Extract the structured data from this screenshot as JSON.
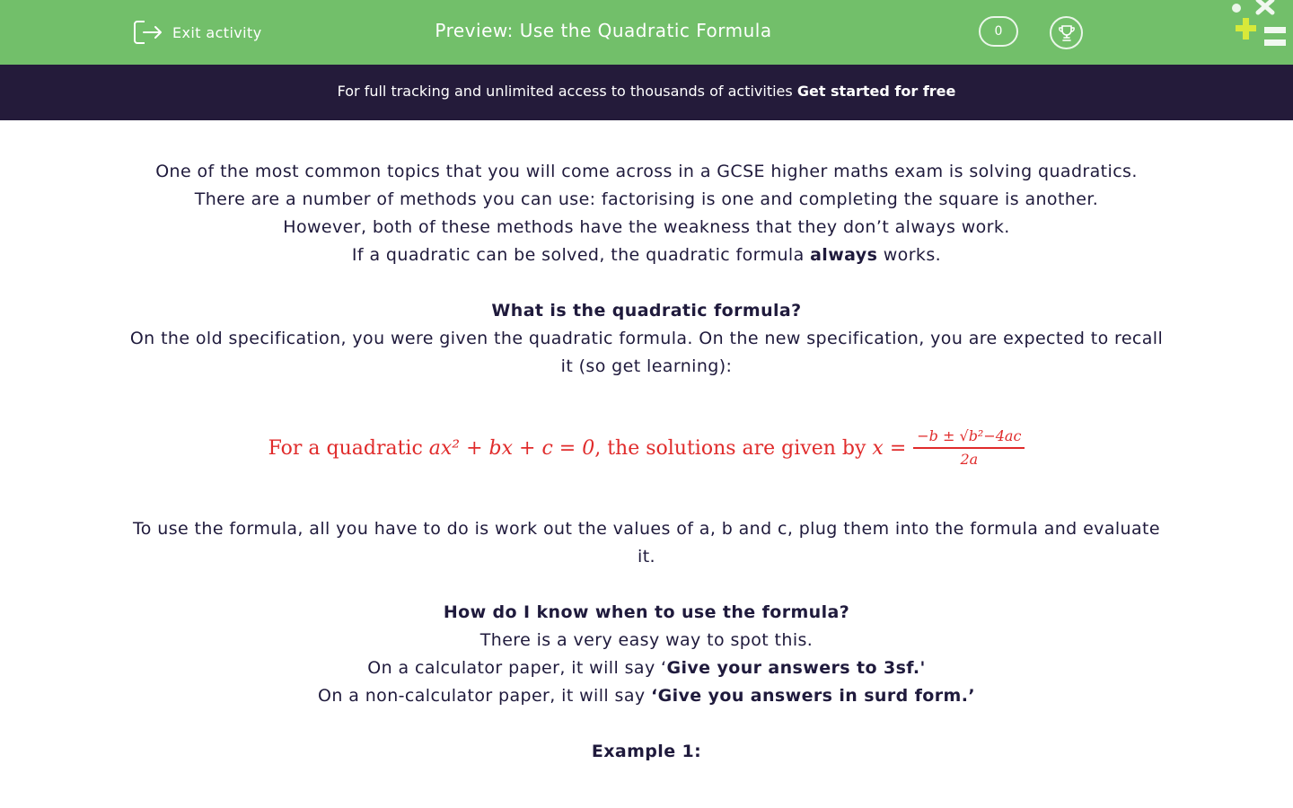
{
  "header": {
    "exit_label": "Exit activity",
    "title": "Preview: Use the Quadratic Formula",
    "score": "0",
    "colors": {
      "bar": "#72bf6a",
      "banner": "#241b3a",
      "formula": "#e02b2b"
    }
  },
  "banner": {
    "text": "For full tracking and unlimited access to thousands of activities",
    "cta": "Get started for free"
  },
  "content": {
    "intro_1": "One of the most common topics that you will come across in a GCSE higher maths exam is solving quadratics.",
    "intro_2": "There are a number of methods you can use: factorising is one and completing the square is another.",
    "intro_3": "However, both of these methods have the weakness that they don’t always work.",
    "intro_4_a": "If a quadratic can be solved, the quadratic formula",
    "intro_4_b": "always",
    "intro_4_c": "works.",
    "heading_1": "What is the quadratic formula?",
    "spec": "On the old specification, you were given the quadratic formula. On the new specification, you are expected to recall it (so get learning):",
    "formula": {
      "lead": "For a quadratic",
      "equation": "ax² + bx + c = 0",
      "mid": ", the solutions are given by",
      "lhs": "x =",
      "numerator": "−b ± √b²−4ac",
      "denominator": "2a"
    },
    "use": "To use the formula, all you have to do is work out the values of a, b and c,  plug them into the formula and evaluate it.",
    "heading_2": "How do I know when to use the formula?",
    "easy": "There is a very easy way to spot this.",
    "calc_a": "On a calculator paper, it will say ‘",
    "calc_b": "Give your answers to 3sf.'",
    "noncalc_a": "On a non-calculator paper, it will say",
    "noncalc_b": "‘Give you answers in surd form.’",
    "example": "Example 1:"
  }
}
